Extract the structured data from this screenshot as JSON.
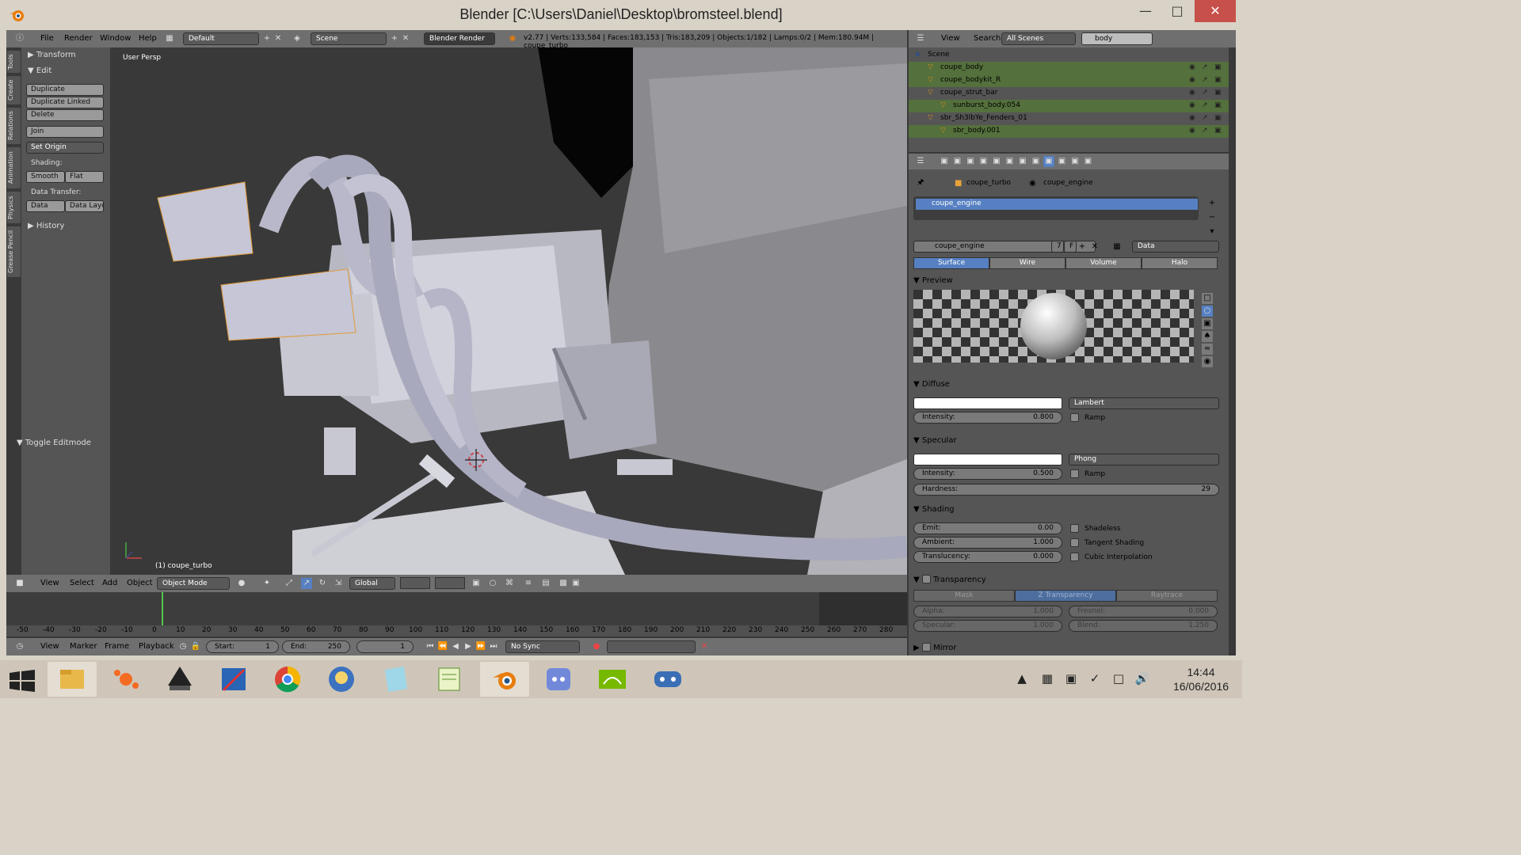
{
  "window": {
    "title": "Blender [C:\\Users\\Daniel\\Desktop\\bromsteel.blend]"
  },
  "info_header": {
    "menus": [
      "File",
      "Render",
      "Window",
      "Help"
    ],
    "screen": "Default",
    "scene": "Scene",
    "engine": "Blender Render",
    "stats": "v2.77 | Verts:133,584 | Faces:183,153 | Tris:183,209 | Objects:1/182 | Lamps:0/2 | Mem:180.94M | coupe_turbo"
  },
  "tool_tabs": [
    "Tools",
    "Create",
    "Relations",
    "Animation",
    "Physics",
    "Grease Pencil"
  ],
  "toolshelf": {
    "transform": "Transform",
    "edit": "Edit",
    "duplicate": "Duplicate",
    "duplicate_linked": "Duplicate Linked",
    "delete": "Delete",
    "join": "Join",
    "set_origin": "Set Origin",
    "shading_label": "Shading:",
    "smooth": "Smooth",
    "flat": "Flat",
    "data_transfer_label": "Data Transfer:",
    "data": "Data",
    "data_layo": "Data Layo",
    "history": "History",
    "toggle_editmode": "Toggle Editmode"
  },
  "viewport": {
    "persp_label": "User Persp",
    "object_label": "(1) coupe_turbo"
  },
  "viewport_header": {
    "menus": [
      "View",
      "Select",
      "Add",
      "Object"
    ],
    "mode": "Object Mode",
    "orientation": "Global"
  },
  "timeline": {
    "ticks": [
      "-50",
      "-40",
      "-30",
      "-20",
      "-10",
      "0",
      "10",
      "20",
      "30",
      "40",
      "50",
      "60",
      "70",
      "80",
      "90",
      "100",
      "110",
      "120",
      "130",
      "140",
      "150",
      "160",
      "170",
      "180",
      "190",
      "200",
      "210",
      "220",
      "230",
      "240",
      "250",
      "260",
      "270",
      "280"
    ],
    "menus": [
      "View",
      "Marker",
      "Frame",
      "Playback"
    ],
    "start_label": "Start:",
    "start": "1",
    "end_label": "End:",
    "end": "250",
    "current": "1",
    "sync": "No Sync"
  },
  "outliner": {
    "menus": [
      "View",
      "Search"
    ],
    "display": "All Scenes",
    "search": "body",
    "rows": [
      {
        "name": "Scene",
        "indent": 0,
        "sel": false
      },
      {
        "name": "coupe_body",
        "indent": 1,
        "sel": true
      },
      {
        "name": "coupe_bodykit_R",
        "indent": 1,
        "sel": true
      },
      {
        "name": "coupe_strut_bar",
        "indent": 1,
        "sel": false
      },
      {
        "name": "sunburst_body.054",
        "indent": 2,
        "sel": true
      },
      {
        "name": "sbr_Sh3lbYe_Fenders_01",
        "indent": 1,
        "sel": false
      },
      {
        "name": "sbr_body.001",
        "indent": 2,
        "sel": true
      }
    ]
  },
  "properties": {
    "breadcrumb_obj": "coupe_turbo",
    "breadcrumb_mat": "coupe_engine",
    "slot": "coupe_engine",
    "material": "coupe_engine",
    "users": "7",
    "fake": "F",
    "link": "Data",
    "tabs": [
      "Surface",
      "Wire",
      "Volume",
      "Halo"
    ],
    "preview": "Preview",
    "diffuse": {
      "title": "Diffuse",
      "shader": "Lambert",
      "intensity_label": "Intensity:",
      "intensity": "0.800",
      "ramp": "Ramp"
    },
    "specular": {
      "title": "Specular",
      "shader": "Phong",
      "intensity_label": "Intensity:",
      "intensity": "0.500",
      "ramp": "Ramp",
      "hardness_label": "Hardness:",
      "hardness": "29"
    },
    "shading": {
      "title": "Shading",
      "emit_label": "Emit:",
      "emit": "0.00",
      "ambient_label": "Ambient:",
      "ambient": "1.000",
      "translucency_label": "Translucency:",
      "translucency": "0.000",
      "shadeless": "Shadeless",
      "tangent": "Tangent Shading",
      "cubic": "Cubic Interpolation"
    },
    "transparency": {
      "title": "Transparency",
      "modes": [
        "Mask",
        "Z Transparency",
        "Raytrace"
      ],
      "alpha_label": "Alpha:",
      "alpha": "1.000",
      "fresnel_label": "Fresnel:",
      "fresnel": "0.000",
      "specular_label": "Specular:",
      "specular": "1.000",
      "blend_label": "Blend:",
      "blend": "1.250"
    },
    "mirror": "Mirror"
  },
  "taskbar": {
    "time": "14:44",
    "date": "16/06/2016"
  },
  "colors": {
    "accent": "#5680c2",
    "selected_row": "#54703c",
    "close": "#c7504a"
  }
}
